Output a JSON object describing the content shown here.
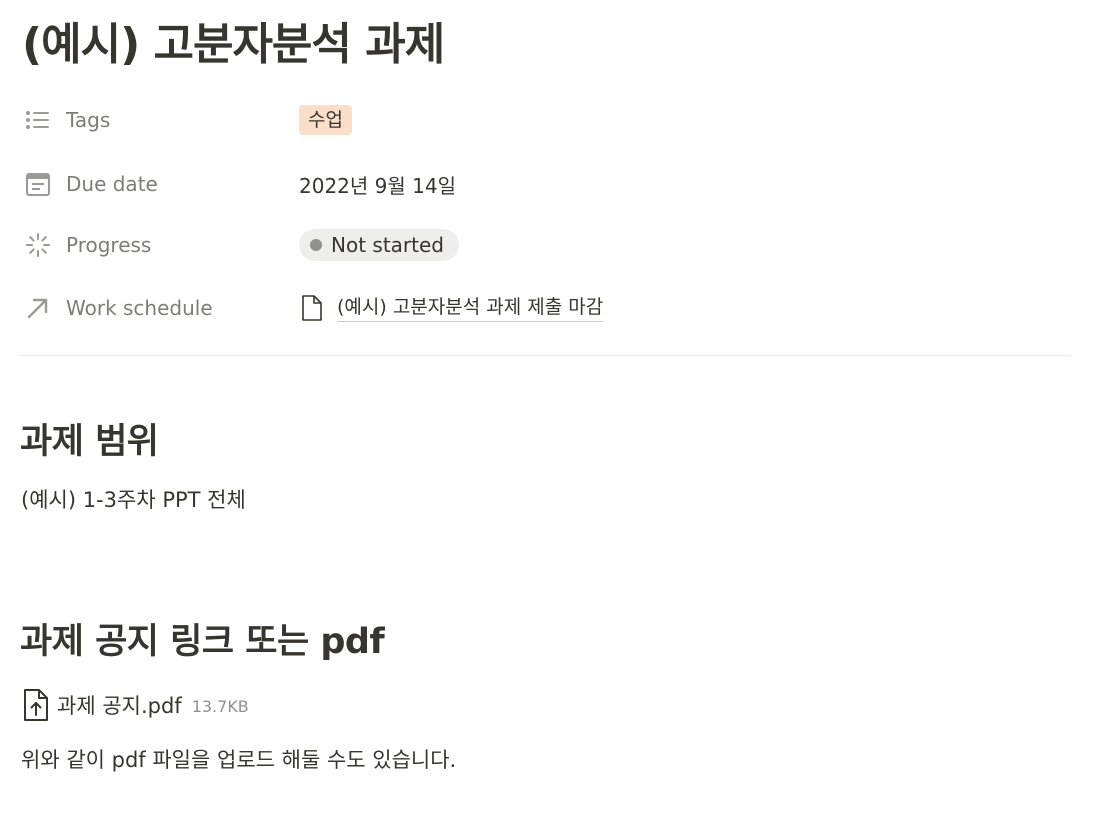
{
  "page": {
    "title": "(예시) 고분자분석 과제"
  },
  "properties": [
    {
      "name": "Tags",
      "icon": "list-icon",
      "value": "수업"
    },
    {
      "name": "Due date",
      "icon": "calendar-icon",
      "value": "2022년 9월 14일"
    },
    {
      "name": "Progress",
      "icon": "progress-spinner-icon",
      "value": "Not started"
    },
    {
      "name": "Work schedule",
      "icon": "relation-arrow-icon",
      "value": "(예시) 고분자분석 과제 제출 마감"
    }
  ],
  "sections": {
    "scope": {
      "heading": "과제 범위",
      "body": "(예시) 1-3주차 PPT 전체"
    },
    "notice": {
      "heading": "과제 공지 링크 또는 pdf",
      "file_name": "과제 공지.pdf",
      "file_size": "13.7KB",
      "body": "위와 같이 pdf 파일을 업로드 해둘 수도 있습니다."
    }
  },
  "colors": {
    "text": "#37352f",
    "tag_bg": "#fadec9",
    "status_bg": "#eeeeec",
    "status_dot": "#91918e",
    "divider": "#e9e9e7"
  }
}
